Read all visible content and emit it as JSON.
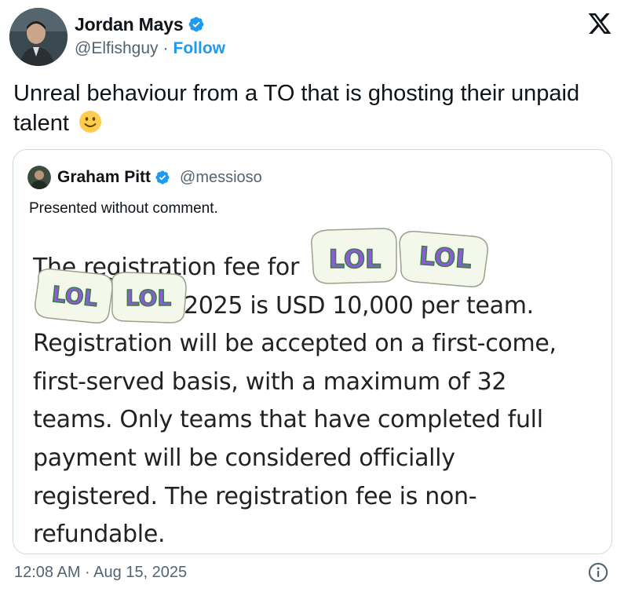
{
  "author": {
    "display_name": "Jordan Mays",
    "handle": "@Elfishguy",
    "separator": "·",
    "follow_label": "Follow",
    "verified_icon": "verified-badge-icon"
  },
  "platform_icon": "x-logo-icon",
  "tweet": {
    "text": "Unreal behaviour from a TO that is ghosting their unpaid talent",
    "emoji": "slightly-smiling-face"
  },
  "quote": {
    "display_name": "Graham Pitt",
    "handle": "@messioso",
    "text": "Presented without comment.",
    "image_text": {
      "line1": "The registration fee for",
      "line2": "2025 is USD 10,000 per team.",
      "line3": "Registration will be accepted on a first-come,",
      "line4": "first-served basis, with a maximum of 32",
      "line5": "teams. Only teams that have completed full",
      "line6": "payment will be considered officially",
      "line7": "registered. The registration fee is non-",
      "line8": "refundable."
    },
    "sticker_text": "LOL"
  },
  "footer": {
    "timestamp": "12:08 AM · Aug 15, 2025",
    "info_icon": "info-icon"
  },
  "colors": {
    "link": "#1d9bf0",
    "secondary_text": "#536471",
    "border": "#cfd9de",
    "sticker_fill": "#8a5cd6",
    "sticker_outline": "#6ac26e"
  }
}
